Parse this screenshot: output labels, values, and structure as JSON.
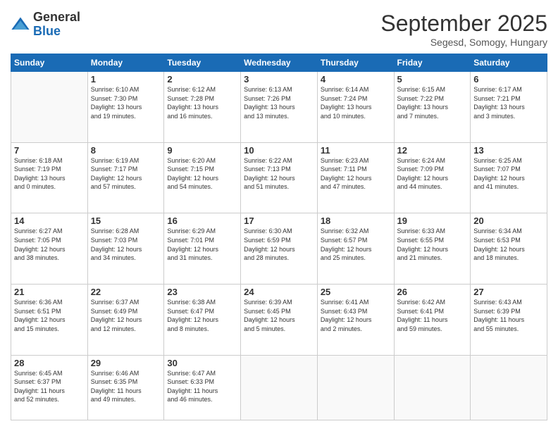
{
  "logo": {
    "general": "General",
    "blue": "Blue"
  },
  "title": "September 2025",
  "subtitle": "Segesd, Somogy, Hungary",
  "days_header": [
    "Sunday",
    "Monday",
    "Tuesday",
    "Wednesday",
    "Thursday",
    "Friday",
    "Saturday"
  ],
  "weeks": [
    [
      {
        "day": "",
        "info": ""
      },
      {
        "day": "1",
        "info": "Sunrise: 6:10 AM\nSunset: 7:30 PM\nDaylight: 13 hours\nand 19 minutes."
      },
      {
        "day": "2",
        "info": "Sunrise: 6:12 AM\nSunset: 7:28 PM\nDaylight: 13 hours\nand 16 minutes."
      },
      {
        "day": "3",
        "info": "Sunrise: 6:13 AM\nSunset: 7:26 PM\nDaylight: 13 hours\nand 13 minutes."
      },
      {
        "day": "4",
        "info": "Sunrise: 6:14 AM\nSunset: 7:24 PM\nDaylight: 13 hours\nand 10 minutes."
      },
      {
        "day": "5",
        "info": "Sunrise: 6:15 AM\nSunset: 7:22 PM\nDaylight: 13 hours\nand 7 minutes."
      },
      {
        "day": "6",
        "info": "Sunrise: 6:17 AM\nSunset: 7:21 PM\nDaylight: 13 hours\nand 3 minutes."
      }
    ],
    [
      {
        "day": "7",
        "info": "Sunrise: 6:18 AM\nSunset: 7:19 PM\nDaylight: 13 hours\nand 0 minutes."
      },
      {
        "day": "8",
        "info": "Sunrise: 6:19 AM\nSunset: 7:17 PM\nDaylight: 12 hours\nand 57 minutes."
      },
      {
        "day": "9",
        "info": "Sunrise: 6:20 AM\nSunset: 7:15 PM\nDaylight: 12 hours\nand 54 minutes."
      },
      {
        "day": "10",
        "info": "Sunrise: 6:22 AM\nSunset: 7:13 PM\nDaylight: 12 hours\nand 51 minutes."
      },
      {
        "day": "11",
        "info": "Sunrise: 6:23 AM\nSunset: 7:11 PM\nDaylight: 12 hours\nand 47 minutes."
      },
      {
        "day": "12",
        "info": "Sunrise: 6:24 AM\nSunset: 7:09 PM\nDaylight: 12 hours\nand 44 minutes."
      },
      {
        "day": "13",
        "info": "Sunrise: 6:25 AM\nSunset: 7:07 PM\nDaylight: 12 hours\nand 41 minutes."
      }
    ],
    [
      {
        "day": "14",
        "info": "Sunrise: 6:27 AM\nSunset: 7:05 PM\nDaylight: 12 hours\nand 38 minutes."
      },
      {
        "day": "15",
        "info": "Sunrise: 6:28 AM\nSunset: 7:03 PM\nDaylight: 12 hours\nand 34 minutes."
      },
      {
        "day": "16",
        "info": "Sunrise: 6:29 AM\nSunset: 7:01 PM\nDaylight: 12 hours\nand 31 minutes."
      },
      {
        "day": "17",
        "info": "Sunrise: 6:30 AM\nSunset: 6:59 PM\nDaylight: 12 hours\nand 28 minutes."
      },
      {
        "day": "18",
        "info": "Sunrise: 6:32 AM\nSunset: 6:57 PM\nDaylight: 12 hours\nand 25 minutes."
      },
      {
        "day": "19",
        "info": "Sunrise: 6:33 AM\nSunset: 6:55 PM\nDaylight: 12 hours\nand 21 minutes."
      },
      {
        "day": "20",
        "info": "Sunrise: 6:34 AM\nSunset: 6:53 PM\nDaylight: 12 hours\nand 18 minutes."
      }
    ],
    [
      {
        "day": "21",
        "info": "Sunrise: 6:36 AM\nSunset: 6:51 PM\nDaylight: 12 hours\nand 15 minutes."
      },
      {
        "day": "22",
        "info": "Sunrise: 6:37 AM\nSunset: 6:49 PM\nDaylight: 12 hours\nand 12 minutes."
      },
      {
        "day": "23",
        "info": "Sunrise: 6:38 AM\nSunset: 6:47 PM\nDaylight: 12 hours\nand 8 minutes."
      },
      {
        "day": "24",
        "info": "Sunrise: 6:39 AM\nSunset: 6:45 PM\nDaylight: 12 hours\nand 5 minutes."
      },
      {
        "day": "25",
        "info": "Sunrise: 6:41 AM\nSunset: 6:43 PM\nDaylight: 12 hours\nand 2 minutes."
      },
      {
        "day": "26",
        "info": "Sunrise: 6:42 AM\nSunset: 6:41 PM\nDaylight: 11 hours\nand 59 minutes."
      },
      {
        "day": "27",
        "info": "Sunrise: 6:43 AM\nSunset: 6:39 PM\nDaylight: 11 hours\nand 55 minutes."
      }
    ],
    [
      {
        "day": "28",
        "info": "Sunrise: 6:45 AM\nSunset: 6:37 PM\nDaylight: 11 hours\nand 52 minutes."
      },
      {
        "day": "29",
        "info": "Sunrise: 6:46 AM\nSunset: 6:35 PM\nDaylight: 11 hours\nand 49 minutes."
      },
      {
        "day": "30",
        "info": "Sunrise: 6:47 AM\nSunset: 6:33 PM\nDaylight: 11 hours\nand 46 minutes."
      },
      {
        "day": "",
        "info": ""
      },
      {
        "day": "",
        "info": ""
      },
      {
        "day": "",
        "info": ""
      },
      {
        "day": "",
        "info": ""
      }
    ]
  ]
}
